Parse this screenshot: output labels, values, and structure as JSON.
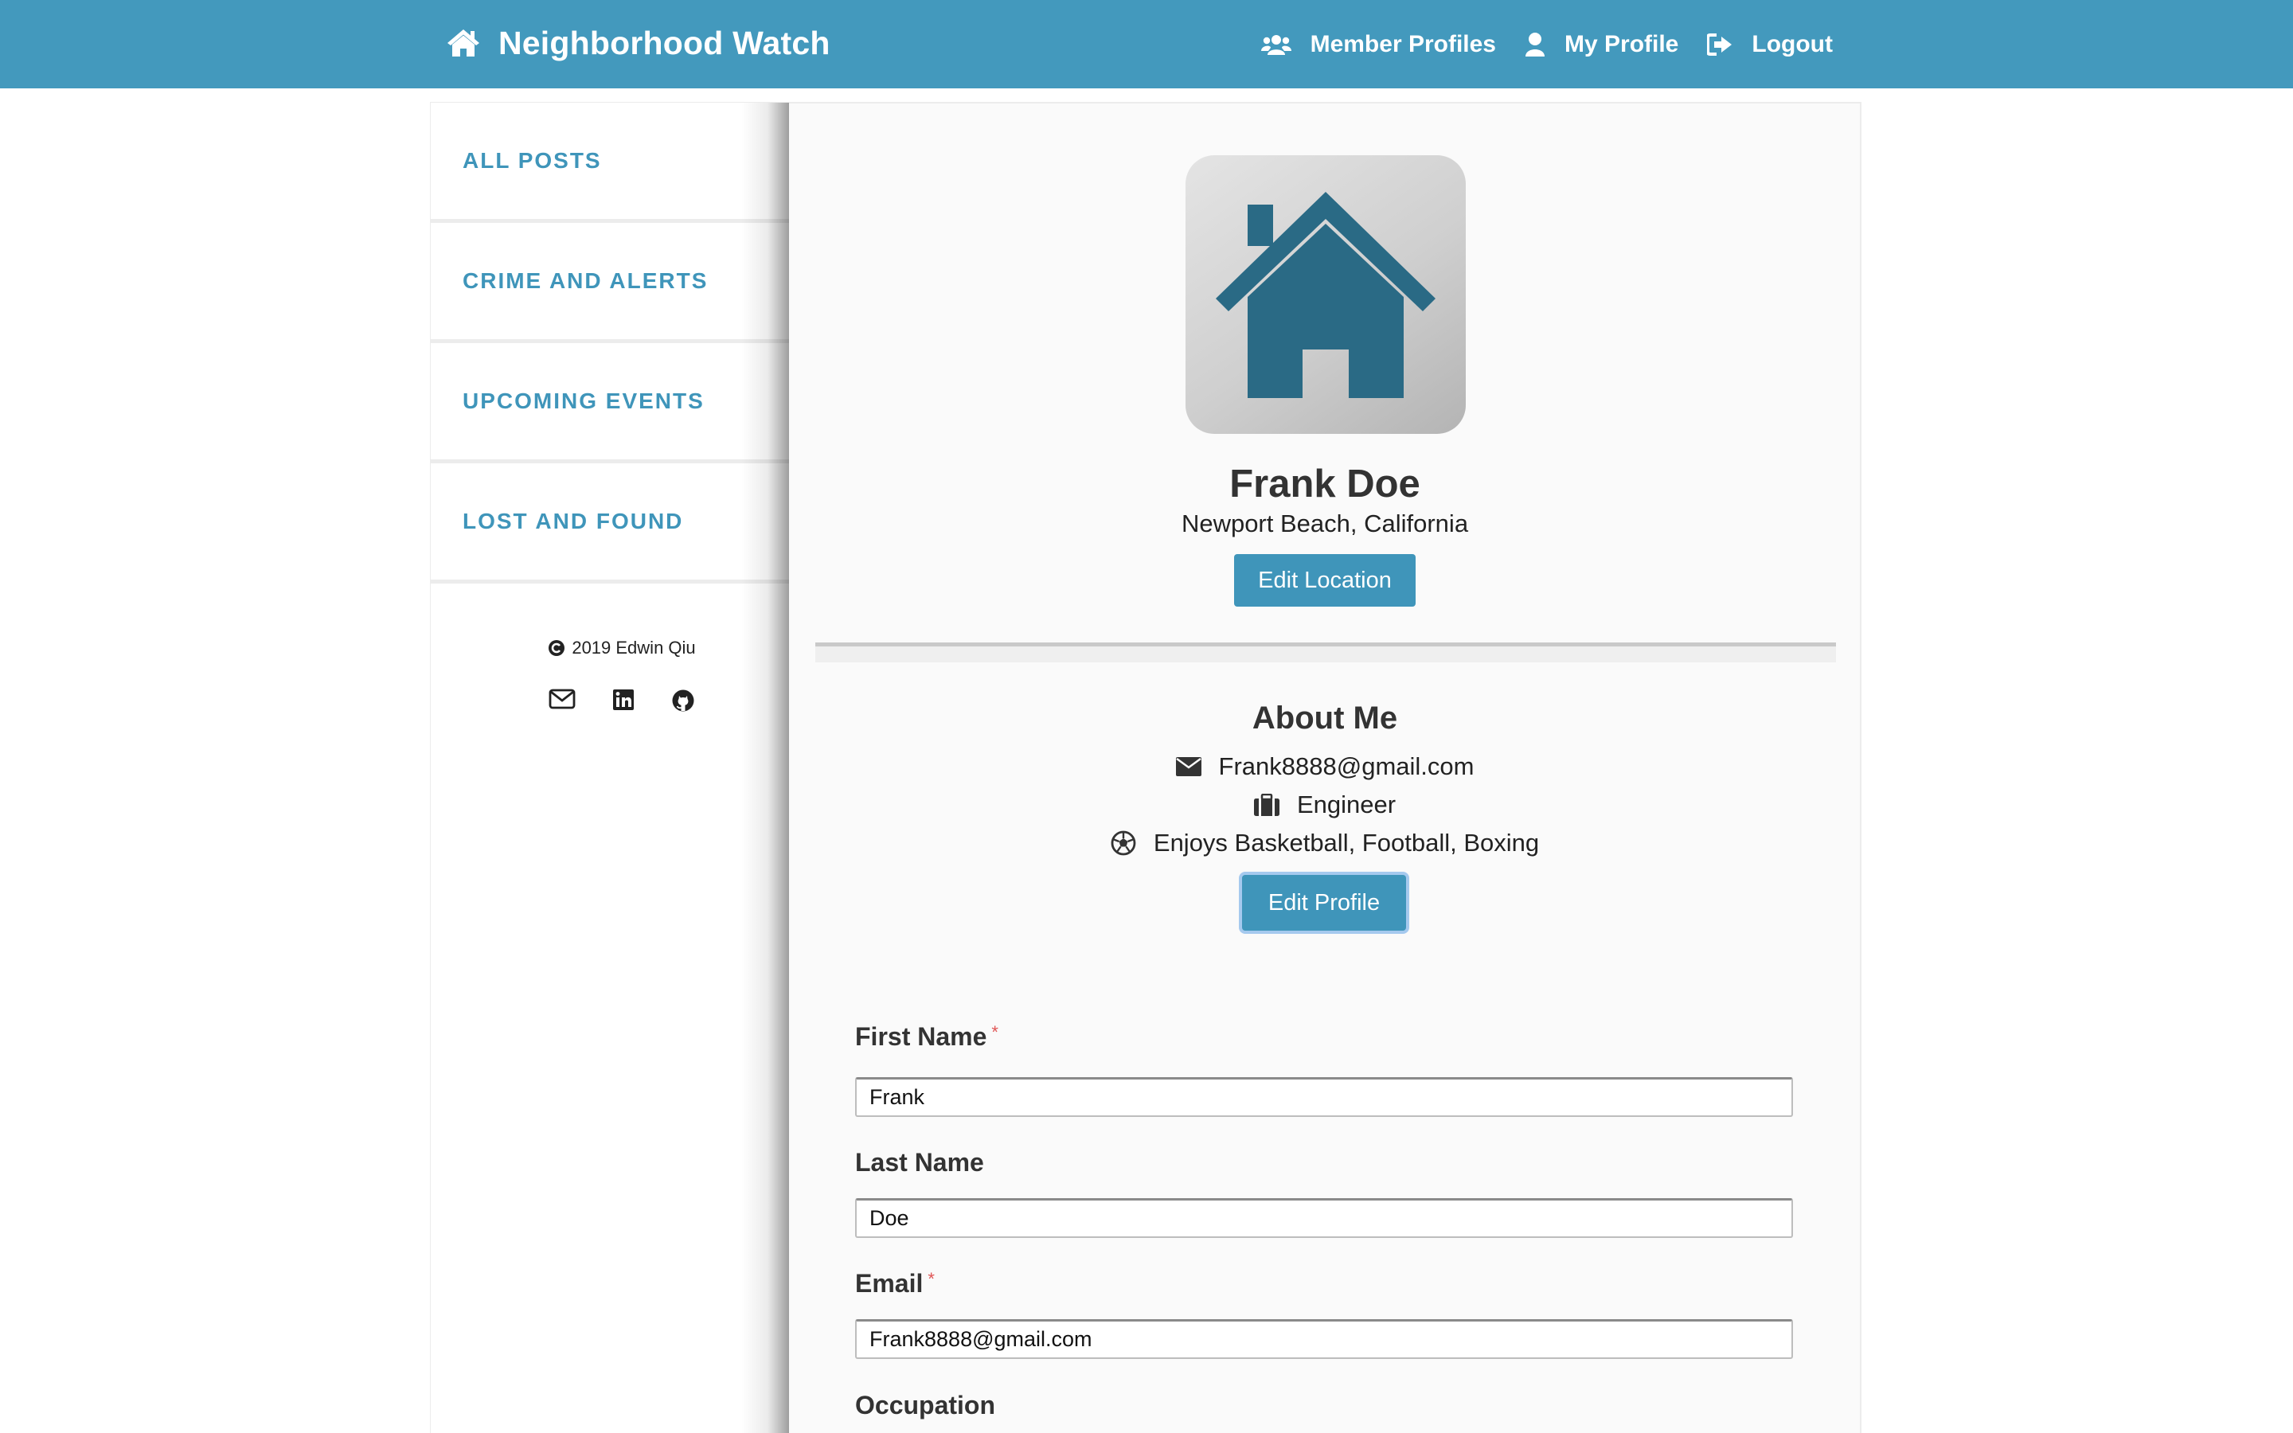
{
  "navbar": {
    "brand": "Neighborhood Watch",
    "brand_icon": "home-icon",
    "items": [
      {
        "label": "Member Profiles",
        "icon": "users-icon"
      },
      {
        "label": "My Profile",
        "icon": "user-icon"
      },
      {
        "label": "Logout",
        "icon": "sign-out-icon"
      }
    ],
    "color": "#4399bd"
  },
  "sidebar": {
    "items": [
      {
        "label": "ALL POSTS"
      },
      {
        "label": "CRIME AND ALERTS"
      },
      {
        "label": "UPCOMING EVENTS"
      },
      {
        "label": "LOST AND FOUND"
      }
    ],
    "copyright": "2019 Edwin Qiu",
    "social_icons": [
      "mail-icon",
      "linkedin-icon",
      "github-icon"
    ]
  },
  "profile": {
    "avatar_icon": "house-icon",
    "name": "Frank Doe",
    "location": "Newport Beach, California",
    "edit_location_label": "Edit Location"
  },
  "about": {
    "title": "About Me",
    "email": "Frank8888@gmail.com",
    "occupation": "Engineer",
    "hobbies": "Enjoys Basketball, Football, Boxing",
    "edit_profile_label": "Edit Profile"
  },
  "form": {
    "first_name_label": "First Name",
    "first_name_value": "Frank",
    "last_name_label": "Last Name",
    "last_name_value": "Doe",
    "email_label": "Email",
    "email_value": "Frank8888@gmail.com",
    "occupation_label": "Occupation",
    "required_mark": "*"
  },
  "colors": {
    "accent": "#3f95ba",
    "avatar_house": "#2a6a85"
  }
}
